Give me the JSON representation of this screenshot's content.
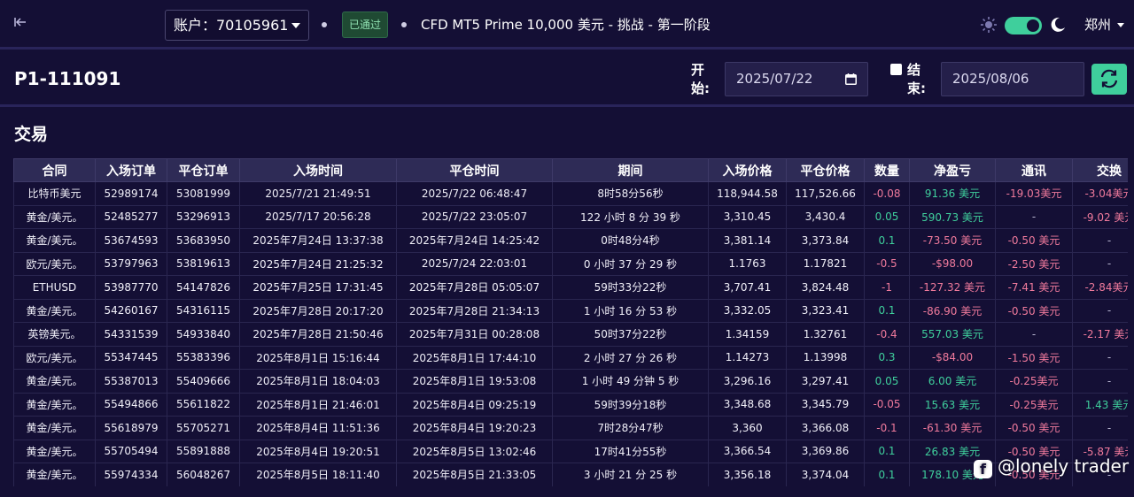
{
  "header": {
    "account_label": "账户：70105961",
    "status_badge": "已通过",
    "challenge_title": "CFD MT5 Prime 10,000 美元 - 挑战 - 第一阶段",
    "theme_toggle_on": true,
    "city": "郑州",
    "icons": {
      "back": "back-arrow-icon",
      "sun": "sun-icon",
      "moon": "moon-icon"
    },
    "colors": {
      "accent": "#3fcf9c",
      "background": "#140f35",
      "badge_bg": "#1f4a33"
    }
  },
  "filters": {
    "page_title": "P1-111091",
    "start_label": "开始:",
    "start_date": "2025/07/22",
    "end_label": "结束:",
    "end_date": "2025/08/06",
    "end_checked": false,
    "refresh_icon": "refresh-icon"
  },
  "trades": {
    "section_title": "交易",
    "columns": [
      "合同",
      "入场订单",
      "平仓订单",
      "入场时间",
      "平仓时间",
      "期间",
      "入场价格",
      "平仓价格",
      "数量",
      "净盈亏",
      "通讯",
      "交换"
    ],
    "rows": [
      [
        "比特币美元",
        "52989174",
        "53081999",
        "2025/7/21 21:49:51",
        "2025/7/22 06:48:47",
        "8时58分56秒",
        "118,944.58",
        "117,526.66",
        "-0.08",
        "91.36 美元",
        "-19.03美元",
        "-3.04美元"
      ],
      [
        "黄金/美元。",
        "52485277",
        "53296913",
        "2025/7/17 20:56:28",
        "2025/7/22 23:05:07",
        "122 小时 8 分 39 秒",
        "3,310.45",
        "3,430.4",
        "0.05",
        "590.73 美元",
        "-",
        "-9.02 美元"
      ],
      [
        "黄金/美元。",
        "53674593",
        "53683950",
        "2025年7月24日 13:37:38",
        "2025年7月24日 14:25:42",
        "0时48分4秒",
        "3,381.14",
        "3,373.84",
        "0.1",
        "-73.50 美元",
        "-0.50 美元",
        "-"
      ],
      [
        "欧元/美元。",
        "53797963",
        "53819613",
        "2025年7月24日 21:25:32",
        "2025/7/24 22:03:01",
        "0 小时 37 分 29 秒",
        "1.1763",
        "1.17821",
        "-0.5",
        "-$98.00",
        "-2.50 美元",
        "-"
      ],
      [
        "ETHUSD",
        "53987770",
        "54147826",
        "2025年7月25日 17:31:45",
        "2025年7月28日 05:05:07",
        "59时33分22秒",
        "3,707.41",
        "3,824.48",
        "-1",
        "-127.32 美元",
        "-7.41 美元",
        "-2.84美元"
      ],
      [
        "黄金/美元。",
        "54260167",
        "54316115",
        "2025年7月28日 20:17:20",
        "2025年7月28日 21:34:13",
        "1 小时 16 分 53 秒",
        "3,332.05",
        "3,323.41",
        "0.1",
        "-86.90 美元",
        "-0.50 美元",
        "-"
      ],
      [
        "英镑美元。",
        "54331539",
        "54933840",
        "2025年7月28日 21:50:46",
        "2025年7月31日 00:28:08",
        "50时37分22秒",
        "1.34159",
        "1.32761",
        "-0.4",
        "557.03 美元",
        "-",
        "-2.17 美元"
      ],
      [
        "欧元/美元。",
        "55347445",
        "55383396",
        "2025年8月1日 15:16:44",
        "2025年8月1日 17:44:10",
        "2 小时 27 分 26 秒",
        "1.14273",
        "1.13998",
        "0.3",
        "-$84.00",
        "-1.50 美元",
        "-"
      ],
      [
        "黄金/美元。",
        "55387013",
        "55409666",
        "2025年8月1日 18:04:03",
        "2025年8月1日 19:53:08",
        "1 小时 49 分钟 5 秒",
        "3,296.16",
        "3,297.41",
        "0.05",
        "6.00 美元",
        "-0.25美元",
        "-"
      ],
      [
        "黄金/美元。",
        "55494866",
        "55611822",
        "2025年8月1日 21:46:01",
        "2025年8月4日 09:25:19",
        "59时39分18秒",
        "3,348.68",
        "3,345.79",
        "-0.05",
        "15.63 美元",
        "-0.25美元",
        "1.43 美元"
      ],
      [
        "黄金/美元。",
        "55618979",
        "55705271",
        "2025年8月4日 11:51:36",
        "2025年8月4日 19:20:23",
        "7时28分47秒",
        "3,360",
        "3,366.08",
        "-0.1",
        "-61.30 美元",
        "-0.50 美元",
        "-"
      ],
      [
        "黄金/美元。",
        "55705494",
        "55891888",
        "2025年8月4日 19:20:51",
        "2025年8月5日 13:02:46",
        "17时41分55秒",
        "3,366.54",
        "3,369.86",
        "0.1",
        "26.83 美元",
        "-0.50 美元",
        "-5.87 美元"
      ],
      [
        "黄金/美元。",
        "55974334",
        "56048267",
        "2025年8月5日 18:11:40",
        "2025年8月5日 21:33:05",
        "3 小时 21 分 25 秒",
        "3,356.18",
        "3,374.04",
        "0.1",
        "178.10 美元",
        "-0.50 美元",
        "-"
      ]
    ]
  },
  "watermark": {
    "text": "@lonely trader",
    "icon": "social-logo-icon"
  }
}
